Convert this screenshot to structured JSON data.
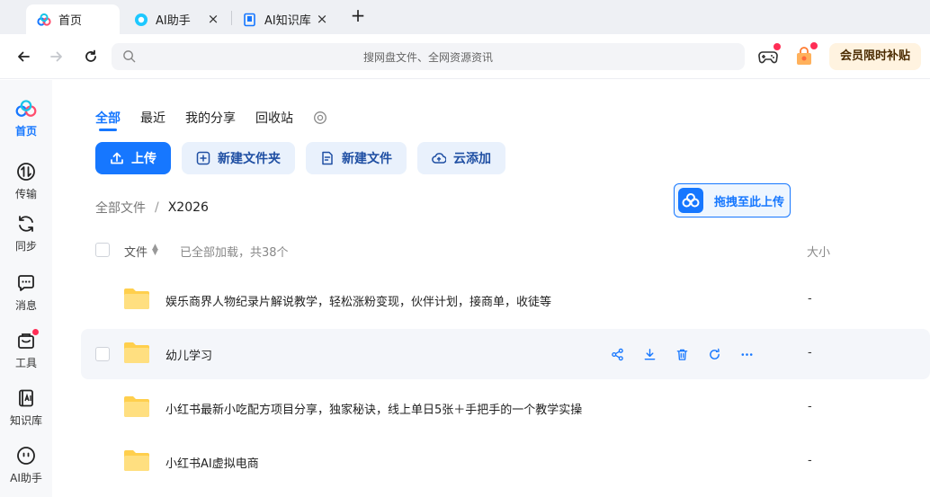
{
  "browser": {
    "tabs": [
      {
        "label": "首页",
        "icon": "baidu-netdisk-logo-icon",
        "active": true
      },
      {
        "label": "AI助手",
        "icon": "ai-assistant-icon",
        "active": false
      },
      {
        "label": "AI知识库",
        "icon": "knowledge-base-icon",
        "active": false
      }
    ],
    "search_placeholder": "搜网盘文件、全网资源资讯",
    "promo_label": "会员限时补贴"
  },
  "sidebar": {
    "items": [
      {
        "label": "首页",
        "icon": "home-cloud-icon",
        "active": true
      },
      {
        "label": "传输",
        "icon": "transfer-icon"
      },
      {
        "label": "同步",
        "icon": "sync-icon"
      },
      {
        "label": "消息",
        "icon": "message-icon"
      },
      {
        "label": "工具",
        "icon": "toolbox-icon",
        "badge": true
      },
      {
        "label": "知识库",
        "icon": "knowledge-base-icon"
      },
      {
        "label": "AI助手",
        "icon": "ai-assistant-icon"
      }
    ]
  },
  "main": {
    "subtabs": [
      {
        "label": "全部",
        "active": true
      },
      {
        "label": "最近"
      },
      {
        "label": "我的分享"
      },
      {
        "label": "回收站"
      }
    ],
    "actions": [
      {
        "label": "上传",
        "icon": "upload-icon",
        "primary": true
      },
      {
        "label": "新建文件夹",
        "icon": "new-folder-icon"
      },
      {
        "label": "新建文件",
        "icon": "new-file-icon"
      },
      {
        "label": "云添加",
        "icon": "cloud-add-icon"
      }
    ],
    "breadcrumb": {
      "root": "全部文件",
      "separator": "/",
      "current": "X2026"
    },
    "drag_upload_label": "拖拽至此上传",
    "list_header": {
      "name": "文件",
      "loaded_text": "已全部加载，共38个",
      "size": "大小"
    },
    "files": [
      {
        "name": "娱乐商界人物纪录片解说教学，轻松涨粉变现，伙伴计划，接商单，收徒等",
        "size": "-"
      },
      {
        "name": "幼儿学习",
        "size": "-",
        "hover": true
      },
      {
        "name": "小红书最新小吃配方项目分享，独家秘诀，线上单日5张＋手把手的一个教学实操",
        "size": "-"
      },
      {
        "name": "小红书AI虚拟电商",
        "size": "-"
      }
    ]
  },
  "colors": {
    "accent": "#1677ff",
    "folder": "#ffd35c",
    "badge": "#ff2d55"
  }
}
